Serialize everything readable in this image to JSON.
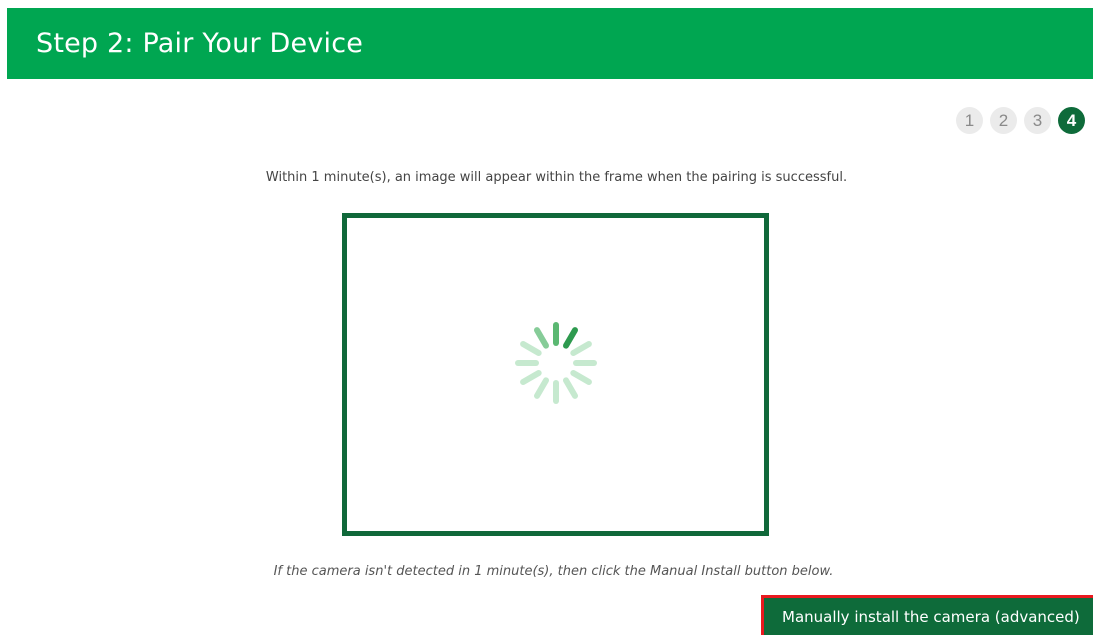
{
  "header": {
    "title": "Step 2: Pair Your Device",
    "background_color": "#00a651"
  },
  "stepper": {
    "steps": [
      "1",
      "2",
      "3",
      "4"
    ],
    "active_step": "4",
    "active_color": "#0e6b3a"
  },
  "instruction_text": "Within 1 minute(s), an image will appear within the frame when the pairing is successful.",
  "frame": {
    "border_color": "#10683a",
    "loading_icon": "spinner-icon"
  },
  "hint_text": "If the camera isn't detected in 1 minute(s), then click the Manual Install button below.",
  "manual_install_button": {
    "label": "Manually install the camera (advanced)",
    "background_color": "#0e6b3a",
    "highlight_color": "#e8191f"
  }
}
